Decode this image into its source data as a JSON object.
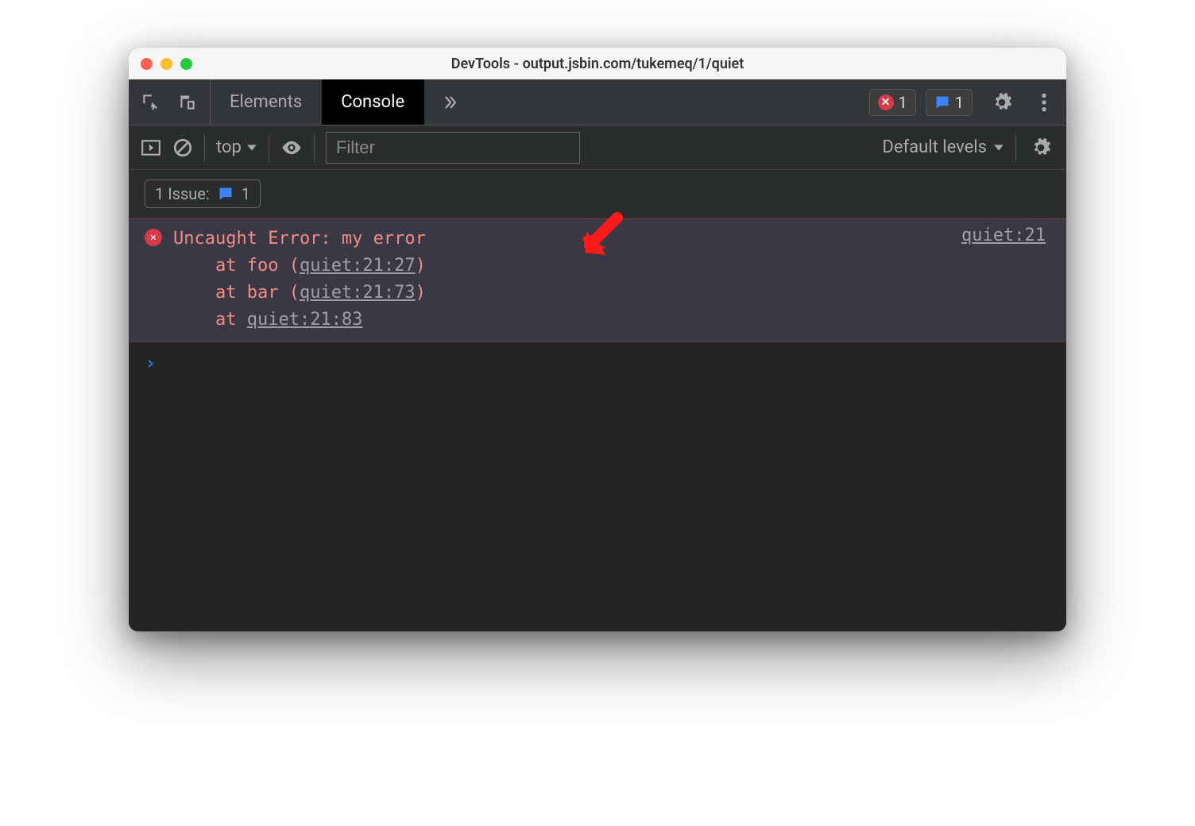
{
  "window": {
    "title": "DevTools - output.jsbin.com/tukemeq/1/quiet"
  },
  "tabs": {
    "elements": "Elements",
    "console": "Console"
  },
  "badges": {
    "error_count": "1",
    "issue_count": "1"
  },
  "toolbar": {
    "context_label": "top",
    "filter_placeholder": "Filter",
    "levels_label": "Default levels"
  },
  "issues": {
    "label": "1 Issue:",
    "count": "1"
  },
  "error": {
    "message": "Uncaught Error: my error",
    "stack": [
      {
        "prefix": "    at foo (",
        "link": "quiet:21:27",
        "suffix": ")"
      },
      {
        "prefix": "    at bar (",
        "link": "quiet:21:73",
        "suffix": ")"
      },
      {
        "prefix": "    at ",
        "link": "quiet:21:83",
        "suffix": ""
      }
    ],
    "source_link": "quiet:21"
  },
  "prompt_symbol": "›"
}
